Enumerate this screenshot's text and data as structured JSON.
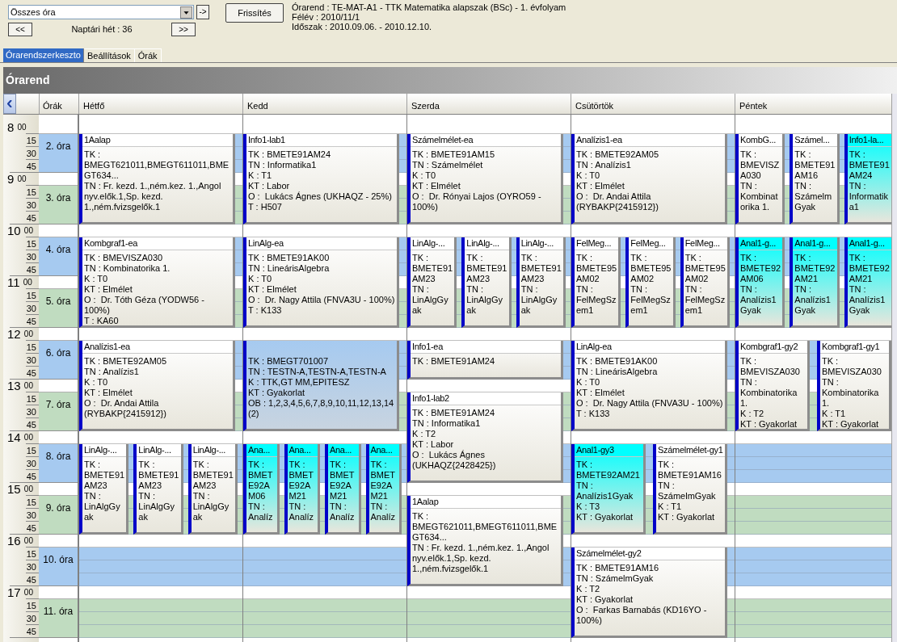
{
  "toolbar": {
    "filter": {
      "value": "Összes óra"
    },
    "go_button": "->",
    "refresh_button": "Frissítés",
    "prev_week": "<<",
    "week_label": "Naptári hét : 36",
    "next_week": ">>"
  },
  "info": [
    "Órarend : TE-MAT-A1 - TTK Matematika alapszak (BSc) - 1. évfolyam",
    "Félév : 2010/11/1",
    "Időszak : 2010.09.06. - 2010.12.10."
  ],
  "tabs": [
    {
      "label": "Órarendszerkeszto",
      "selected": true
    },
    {
      "label": "Beállítások",
      "selected": false
    },
    {
      "label": "Órák",
      "selected": false
    }
  ],
  "panel_title": "Órarend",
  "periods_header": "Órák",
  "timeline": [
    {
      "hour": "8",
      "minutes": [
        "00",
        "15",
        "30",
        "45"
      ],
      "period": "2. óra",
      "color": "#a6caf0"
    },
    {
      "hour": "9",
      "minutes": [
        "00",
        "15",
        "30",
        "45"
      ],
      "period": "3. óra",
      "color": "#c0dcc0"
    },
    {
      "hour": "10",
      "minutes": [
        "00",
        "15",
        "30",
        "45"
      ],
      "period": "4. óra",
      "color": "#a6caf0"
    },
    {
      "hour": "11",
      "minutes": [
        "00",
        "15",
        "30",
        "45"
      ],
      "period": "5. óra",
      "color": "#c0dcc0"
    },
    {
      "hour": "12",
      "minutes": [
        "00",
        "15",
        "30",
        "45"
      ],
      "period": "6. óra",
      "color": "#a6caf0"
    },
    {
      "hour": "13",
      "minutes": [
        "00",
        "15",
        "30",
        "45"
      ],
      "period": "7. óra",
      "color": "#c0dcc0"
    },
    {
      "hour": "14",
      "minutes": [
        "00",
        "15",
        "30",
        "45"
      ],
      "period": "8. óra",
      "color": "#a6caf0"
    },
    {
      "hour": "15",
      "minutes": [
        "00",
        "15",
        "30",
        "45"
      ],
      "period": "9. óra",
      "color": "#c0dcc0"
    },
    {
      "hour": "16",
      "minutes": [
        "00",
        "15",
        "30",
        "45"
      ],
      "period": "10. óra",
      "color": "#a6caf0"
    },
    {
      "hour": "17",
      "minutes": [
        "00",
        "15",
        "30",
        "45"
      ],
      "period": "11. óra",
      "color": "#c0dcc0"
    }
  ],
  "days": [
    {
      "name": "Hétfő",
      "hours": [
        {
          "kind": "double",
          "events": [
            {
              "title": "1Aalap",
              "color": "#ffffff",
              "selected": false,
              "lines": [
                "TK : BMEGT621011,BMEGT611011,BMEGT634...",
                "TN : Fr. kezd. 1.,ném.kez. 1.,Angol nyv.elők.1,Sp. kezd. 1.,ném.fvizsgelők.1"
              ]
            }
          ]
        },
        {
          "kind": "covered"
        },
        {
          "kind": "double",
          "events": [
            {
              "title": "Kombgraf1-ea",
              "color": "#ffffff",
              "selected": false,
              "lines": [
                "TK : BMEVISZA030",
                "TN : Kombinatorika 1.",
                "K : T0",
                "KT : Elmélet",
                "O :  Dr. Tóth Géza (YODW56 - 100%)",
                "T : KA60"
              ]
            }
          ]
        },
        {
          "kind": "covered"
        },
        {
          "kind": "double",
          "events": [
            {
              "title": "Analízis1-ea",
              "color": "#ffffff",
              "selected": false,
              "lines": [
                "TK : BMETE92AM05",
                "TN : Analízis1",
                "K : T0",
                "KT : Elmélet",
                "O :  Dr. Andai Attila (RYBAKP{2415912})"
              ]
            }
          ]
        },
        {
          "kind": "covered"
        },
        {
          "kind": "double",
          "events": [
            {
              "title": "LinAlg-...",
              "color": "#ffffff",
              "selected": false,
              "lines": [
                "TK : BMETE91AM23",
                "TN : LinAlgGyak"
              ]
            },
            {
              "title": "LinAlg-...",
              "color": "#ffffff",
              "selected": false,
              "lines": [
                "TK : BMETE91AM23",
                "TN : LinAlgGyak"
              ]
            },
            {
              "title": "LinAlg-...",
              "color": "#ffffff",
              "selected": false,
              "lines": [
                "TK : BMETE91AM23",
                "TN : LinAlgGyak"
              ]
            }
          ]
        },
        {
          "kind": "covered"
        },
        {
          "kind": "free"
        },
        {
          "kind": "free"
        }
      ]
    },
    {
      "name": "Kedd",
      "hours": [
        {
          "kind": "double",
          "events": [
            {
              "title": "Info1-lab1",
              "color": "#ffffff",
              "selected": false,
              "lines": [
                "TK : BMETE91AM24",
                "TN : Informatika1",
                "K : T1",
                "KT : Labor",
                "O :  Lukács Ágnes (UKHAQZ - 25%)",
                "T : H507"
              ]
            }
          ]
        },
        {
          "kind": "covered"
        },
        {
          "kind": "double",
          "events": [
            {
              "title": "LinAlg-ea",
              "color": "#ffffff",
              "selected": false,
              "lines": [
                "TK : BMETE91AK00",
                "TN : LineárisAlgebra",
                "K : T0",
                "KT : Elmélet",
                "O :  Dr. Nagy Attila (FNVA3U - 100%)",
                "T : K133"
              ]
            }
          ]
        },
        {
          "kind": "covered"
        },
        {
          "kind": "double",
          "events": [
            {
              "selected": true,
              "lines": [
                "TK : BMEGT701007",
                "TN : TESTN-A,TESTN-A,TESTN-A",
                "K : TTK,GT MM,EPITESZ",
                "KT : Gyakorlat",
                "OB : 1,2,3,4,5,6,7,8,9,10,11,12,13,14 (2)"
              ]
            }
          ]
        },
        {
          "kind": "covered"
        },
        {
          "kind": "double",
          "events": [
            {
              "title": "Ana...",
              "color": "#00ffff",
              "selected": false,
              "lines": [
                "TK : BMETE92AM06",
                "TN : Analíz"
              ]
            },
            {
              "title": "Ana...",
              "color": "#00ffff",
              "selected": false,
              "lines": [
                "TK : BMETE92AM21",
                "TN : Analíz"
              ]
            },
            {
              "title": "Ana...",
              "color": "#00ffff",
              "selected": false,
              "lines": [
                "TK : BMETE92AM21",
                "TN : Analíz"
              ]
            },
            {
              "title": "Ana...",
              "color": "#00ffff",
              "selected": false,
              "lines": [
                "TK : BMETE92AM21",
                "TN : Analíz"
              ]
            }
          ]
        },
        {
          "kind": "covered"
        },
        {
          "kind": "free"
        },
        {
          "kind": "free"
        }
      ]
    },
    {
      "name": "Szerda",
      "hours": [
        {
          "kind": "double",
          "events": [
            {
              "title": "Számelmélet-ea",
              "color": "#ffffff",
              "selected": false,
              "lines": [
                "TK : BMETE91AM15",
                "TN : Számelmélet",
                "K : T0",
                "KT : Elmélet",
                "O :  Dr. Rónyai Lajos (OYRO59 - 100%)"
              ]
            }
          ]
        },
        {
          "kind": "covered"
        },
        {
          "kind": "double",
          "events": [
            {
              "title": "LinAlg-...",
              "color": "#ffffff",
              "selected": false,
              "lines": [
                "TK : BMETE91AM23",
                "TN : LinAlgGyak"
              ]
            },
            {
              "title": "LinAlg-...",
              "color": "#ffffff",
              "selected": false,
              "lines": [
                "TK : BMETE91AM23",
                "TN : LinAlgGyak"
              ]
            },
            {
              "title": "LinAlg-...",
              "color": "#ffffff",
              "selected": false,
              "lines": [
                "TK : BMETE91AM23",
                "TN : LinAlgGyak"
              ]
            }
          ]
        },
        {
          "kind": "covered"
        },
        {
          "kind": "single",
          "events": [
            {
              "title": "Info1-ea",
              "color": "#ffffff",
              "selected": false,
              "lines": [
                "TK : BMETE91AM24"
              ]
            }
          ]
        },
        {
          "kind": "double",
          "events": [
            {
              "title": "Info1-lab2",
              "color": "#ffffff",
              "selected": false,
              "lines": [
                "TK : BMETE91AM24",
                "TN : Informatika1",
                "K : T2",
                "KT : Labor",
                "O :  Lukács Ágnes (UKHAQZ{2428425})"
              ]
            }
          ]
        },
        {
          "kind": "covered"
        },
        {
          "kind": "double",
          "events": [
            {
              "title": "1Aalap",
              "color": "#ffffff",
              "selected": false,
              "lines": [
                "TK : BMEGT621011,BMEGT611011,BMEGT634...",
                "TN : Fr. kezd. 1.,ném.kez. 1.,Angol nyv.elők.1,Sp. kezd. 1.,ném.fvizsgelők.1"
              ]
            }
          ]
        },
        {
          "kind": "covered"
        },
        {
          "kind": "free"
        }
      ]
    },
    {
      "name": "Csütörtök",
      "hours": [
        {
          "kind": "double",
          "events": [
            {
              "title": "Analízis1-ea",
              "color": "#ffffff",
              "selected": false,
              "lines": [
                "TK : BMETE92AM05",
                "TN : Analízis1",
                "K : T0",
                "KT : Elmélet",
                "O :  Dr. Andai Attila (RYBAKP{2415912})"
              ]
            }
          ]
        },
        {
          "kind": "covered"
        },
        {
          "kind": "double",
          "events": [
            {
              "title": "FelMeg...",
              "color": "#ffffff",
              "selected": false,
              "lines": [
                "TK : BMETE95AM02",
                "TN : FelMegSzem1"
              ]
            },
            {
              "title": "FelMeg...",
              "color": "#ffffff",
              "selected": false,
              "lines": [
                "TK : BMETE95AM02",
                "TN : FelMegSzem1"
              ]
            },
            {
              "title": "FelMeg...",
              "color": "#ffffff",
              "selected": false,
              "lines": [
                "TK : BMETE95AM02",
                "TN : FelMegSzem1"
              ]
            }
          ]
        },
        {
          "kind": "covered"
        },
        {
          "kind": "double",
          "events": [
            {
              "title": "LinAlg-ea",
              "color": "#ffffff",
              "selected": false,
              "lines": [
                "TK : BMETE91AK00",
                "TN : LineárisAlgebra",
                "K : T0",
                "KT : Elmélet",
                "O :  Dr. Nagy Attila (FNVA3U - 100%)",
                "T : K133"
              ]
            }
          ]
        },
        {
          "kind": "covered"
        },
        {
          "kind": "double",
          "events": [
            {
              "title": "Anal1-gy3",
              "color": "#00ffff",
              "selected": false,
              "lines": [
                "TK : BMETE92AM21",
                "TN : Analízis1Gyak",
                "K : T3",
                "KT : Gyakorlat"
              ]
            },
            {
              "title": "Számelmélet-gy1",
              "color": "#ffffff",
              "selected": false,
              "lines": [
                "TK : BMETE91AM16",
                "TN : SzámelmGyak",
                "K : T1",
                "KT : Gyakorlat"
              ]
            }
          ]
        },
        {
          "kind": "covered"
        },
        {
          "kind": "double",
          "events": [
            {
              "title": "Számelmélet-gy2",
              "color": "#ffffff",
              "selected": false,
              "lines": [
                "TK : BMETE91AM16",
                "TN : SzámelmGyak",
                "K : T2",
                "KT : Gyakorlat",
                "O :  Farkas Barnabás (KD16YO - 100%)"
              ]
            }
          ]
        },
        {
          "kind": "covered"
        }
      ]
    },
    {
      "name": "Péntek",
      "hours": [
        {
          "kind": "double",
          "events": [
            {
              "title": "KombG...",
              "color": "#ffffff",
              "selected": false,
              "lines": [
                "TK : BMEVISZA030",
                "TN : Kombinatorika 1."
              ]
            },
            {
              "title": "Számel...",
              "color": "#ffffff",
              "selected": false,
              "lines": [
                "TK : BMETE91AM16",
                "TN : SzámelmGyak"
              ]
            },
            {
              "title": "Info1-la...",
              "color": "#00ffff",
              "selected": false,
              "lines": [
                "TK : BMETE91AM24",
                "TN : Informatika1"
              ]
            }
          ]
        },
        {
          "kind": "covered"
        },
        {
          "kind": "double",
          "events": [
            {
              "title": "Anal1-g...",
              "color": "#00ffff",
              "selected": false,
              "lines": [
                "TK : BMETE92AM06",
                "TN : Analízis1Gyak"
              ]
            },
            {
              "title": "Anal1-g...",
              "color": "#00ffff",
              "selected": false,
              "lines": [
                "TK : BMETE92AM21",
                "TN : Analízis1Gyak"
              ]
            },
            {
              "title": "Anal1-g...",
              "color": "#00ffff",
              "selected": false,
              "lines": [
                "TK : BMETE92AM21",
                "TN : Analízis1Gyak"
              ]
            }
          ]
        },
        {
          "kind": "covered"
        },
        {
          "kind": "double",
          "events": [
            {
              "title": "Kombgraf1-gy2",
              "color": "#ffffff",
              "selected": false,
              "lines": [
                "TK : BMEVISZA030",
                "TN : Kombinatorika 1.",
                "K : T2",
                "KT : Gyakorlat"
              ]
            },
            {
              "title": "Kombgraf1-gy1",
              "color": "#ffffff",
              "selected": false,
              "lines": [
                "TK : BMEVISZA030",
                "TN : Kombinatorika 1.",
                "K : T1",
                "KT : Gyakorlat"
              ]
            }
          ]
        },
        {
          "kind": "covered"
        },
        {
          "kind": "free"
        },
        {
          "kind": "free"
        },
        {
          "kind": "free"
        },
        {
          "kind": "free"
        }
      ]
    }
  ]
}
